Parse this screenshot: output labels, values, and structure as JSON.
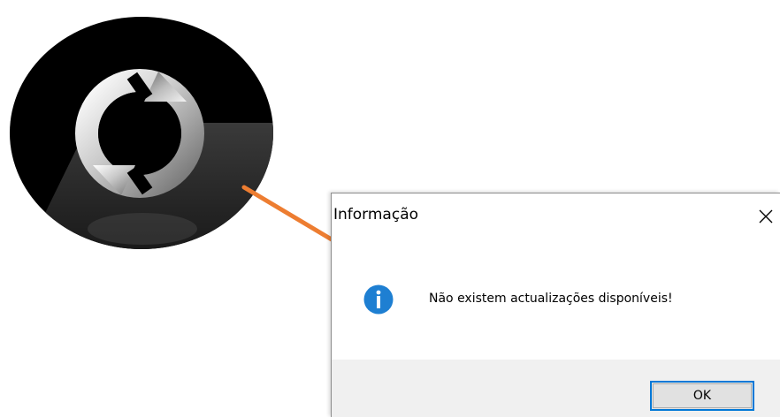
{
  "dialog": {
    "title": "Informação",
    "message": "Não existem actualizações disponíveis!",
    "ok_label": "OK"
  },
  "icons": {
    "illustration": "refresh-arrows-icon",
    "close": "close-icon",
    "info": "info-icon",
    "pointer": "orange-arrow-icon"
  },
  "colors": {
    "arrow": "#ed7d31",
    "info_blue": "#1e7fd2",
    "button_focus_border": "#0078d7",
    "footer_bg": "#f0f0f0"
  }
}
